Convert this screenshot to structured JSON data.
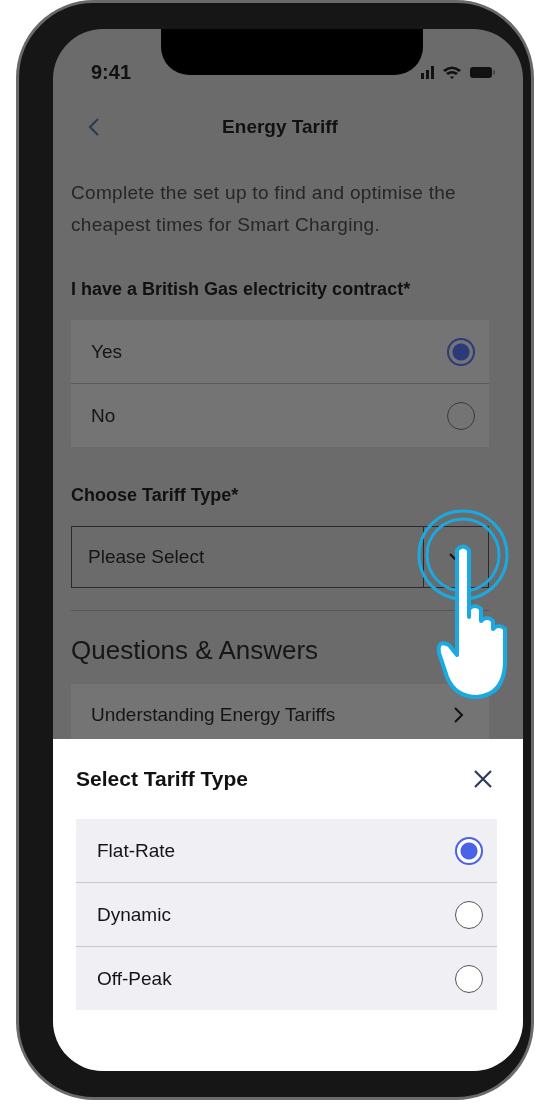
{
  "status_bar": {
    "time": "9:41"
  },
  "nav": {
    "title": "Energy Tariff"
  },
  "intro": "Complete the set up to find and optimise the cheapest times for Smart Charging.",
  "contract_question": {
    "label": "I have a British Gas electricity contract*",
    "options": [
      {
        "label": "Yes",
        "selected": true
      },
      {
        "label": "No",
        "selected": false
      }
    ]
  },
  "tariff_type": {
    "label": "Choose Tariff Type*",
    "placeholder": "Please Select"
  },
  "qa": {
    "title": "Questions & Answers",
    "items": [
      {
        "label": "Understanding Energy Tariffs"
      }
    ]
  },
  "sheet": {
    "title": "Select Tariff Type",
    "options": [
      {
        "label": "Flat-Rate",
        "selected": true
      },
      {
        "label": "Dynamic",
        "selected": false
      },
      {
        "label": "Off-Peak",
        "selected": false
      }
    ]
  }
}
